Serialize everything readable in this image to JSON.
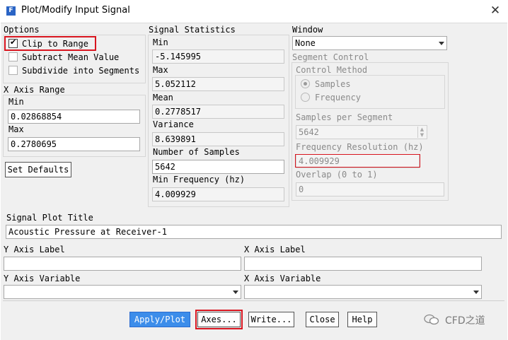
{
  "window": {
    "title": "Plot/Modify Input Signal",
    "icon_letter": "F"
  },
  "options": {
    "title": "Options",
    "clip_to_range": {
      "label": "Clip to Range",
      "checked": true
    },
    "subtract_mean": {
      "label": "Subtract Mean Value",
      "checked": false
    },
    "subdivide": {
      "label": "Subdivide into Segments",
      "checked": false
    }
  },
  "x_axis_range": {
    "title": "X Axis Range",
    "min_label": "Min",
    "min_value": "0.02868854",
    "max_label": "Max",
    "max_value": "0.2780695"
  },
  "set_defaults": "Set Defaults",
  "signal_statistics": {
    "title": "Signal Statistics",
    "min_label": "Min",
    "min_value": "-5.145995",
    "max_label": "Max",
    "max_value": "5.052112",
    "mean_label": "Mean",
    "mean_value": "0.2778517",
    "variance_label": "Variance",
    "variance_value": "8.639891",
    "samples_label": "Number of Samples",
    "samples_value": "5642",
    "minfreq_label": "Min Frequency (hz)",
    "minfreq_value": "4.009929"
  },
  "window_group": {
    "title": "Window",
    "selected": "None"
  },
  "segment_control": {
    "title": "Segment Control",
    "method_title": "Control Method",
    "method_samples": "Samples",
    "method_frequency": "Frequency",
    "samples_per_segment_label": "Samples per Segment",
    "samples_per_segment_value": "5642",
    "freq_res_label": "Frequency Resolution (hz)",
    "freq_res_value": "4.009929",
    "overlap_label": "Overlap (0 to 1)",
    "overlap_value": "0"
  },
  "plot_title": {
    "label": "Signal Plot Title",
    "value": "Acoustic Pressure at Receiver-1"
  },
  "y_axis_label": {
    "label": "Y Axis Label",
    "value": ""
  },
  "x_axis_label": {
    "label": "X Axis Label",
    "value": ""
  },
  "y_axis_variable": {
    "label": "Y Axis Variable",
    "value": ""
  },
  "x_axis_variable": {
    "label": "X Axis Variable",
    "value": ""
  },
  "buttons": {
    "apply_plot": "Apply/Plot",
    "axes": "Axes...",
    "write": "Write...",
    "close": "Close",
    "help": "Help"
  },
  "watermark": "CFD之道",
  "colors": {
    "highlight_red": "#d8151f",
    "primary_blue": "#3c8dea"
  }
}
